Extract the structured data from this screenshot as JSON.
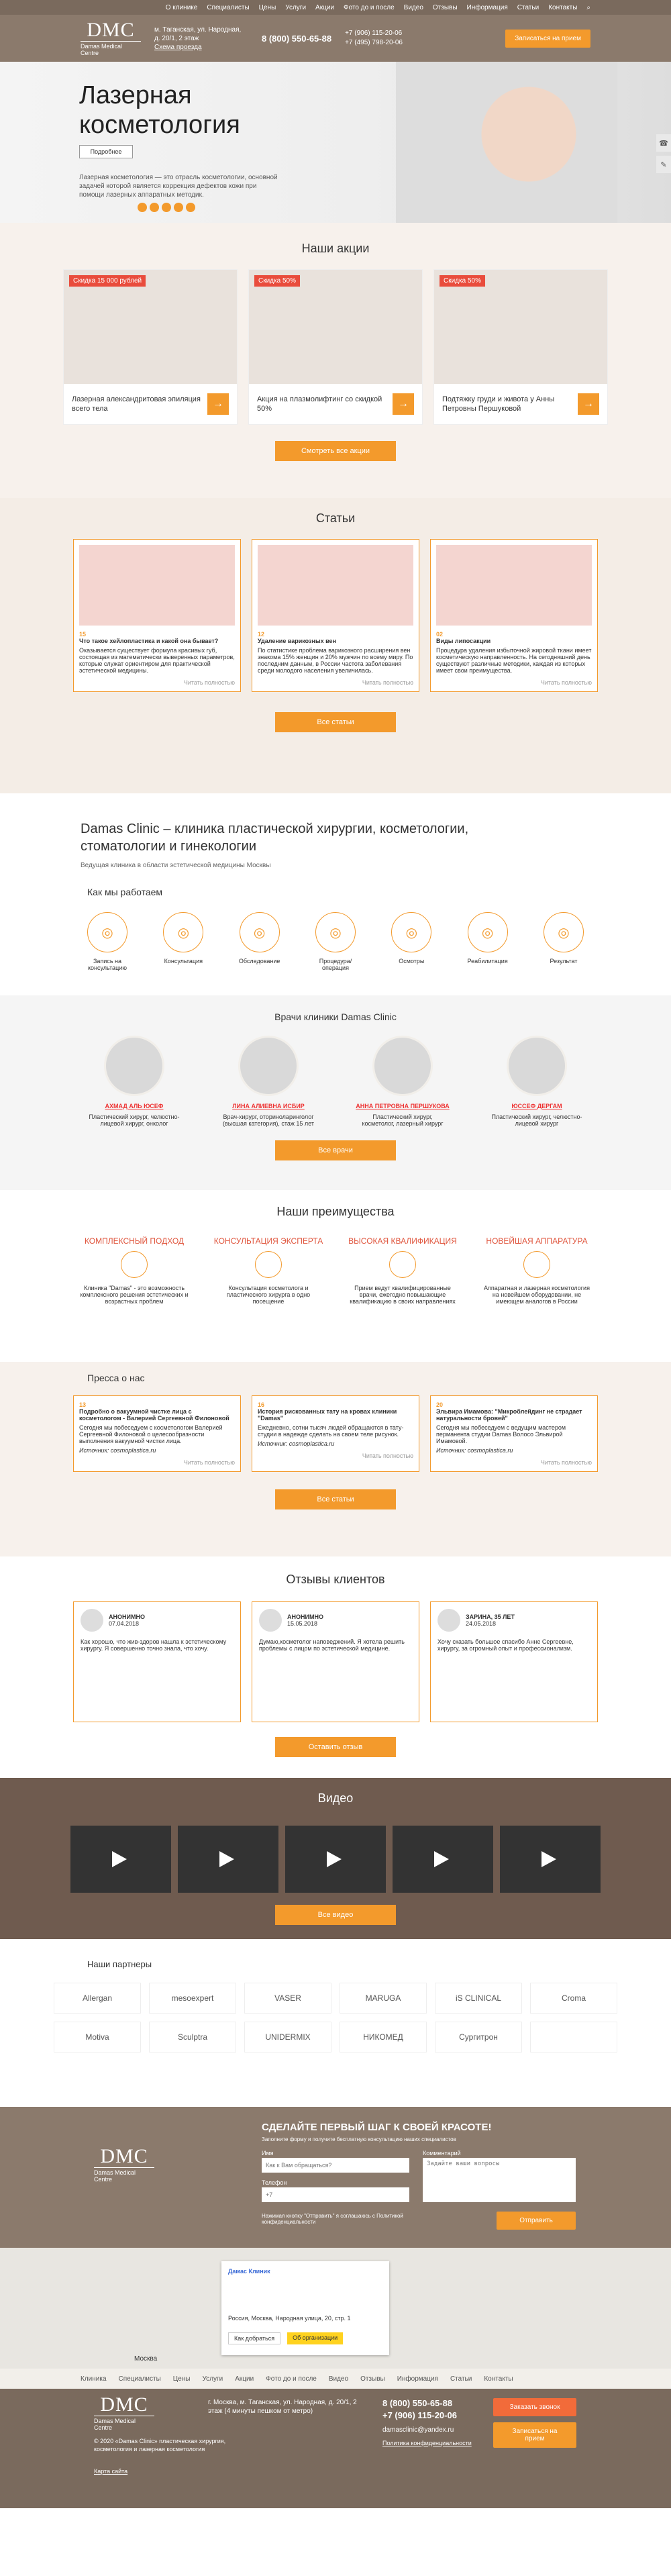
{
  "nav": {
    "items": [
      "О клинике",
      "Специалисты",
      "Цены",
      "Услуги",
      "Акции",
      "Фото до и после",
      "Видео",
      "Отзывы",
      "Информация",
      "Статьи",
      "Контакты"
    ]
  },
  "header": {
    "logo_main": "DMC",
    "logo_sub": "Damas Medical Centre",
    "address": "м. Таганская, ул. Народная, д. 20/1, 2 этаж",
    "address_link": "Схема проезда",
    "phone": "8 (800) 550-65-88",
    "phone2": "+7 (906) 115-20-06",
    "phone3": "+7 (495) 798-20-06",
    "cta": "Записаться на прием"
  },
  "hero": {
    "title": "Лазерная косметология",
    "button": "Подробнее",
    "text": "Лазерная косметология — это отрасль косметологии, основной задачей которой является коррекция дефектов кожи при помощи лазерных аппаратных методик."
  },
  "promos": {
    "title": "Наши акции",
    "button": "Смотреть все акции",
    "items": [
      {
        "tag": "Скидка 15 000 рублей",
        "text": "Лазерная александритовая эпиляция всего тела"
      },
      {
        "tag": "Скидка 50%",
        "text": "Акция на плазмолифтинг со скидкой 50%"
      },
      {
        "tag": "Скидка 50%",
        "text": "Подтяжку груди и живота у Анны Петровны Першуковой"
      }
    ]
  },
  "articles": {
    "title": "Статьи",
    "button": "Все статьи",
    "more": "Читать полностью",
    "items": [
      {
        "date": "15",
        "t": "Что такое хейлопластика и какой она бывает?",
        "d": "Оказывается существует формула красивых губ, состоящая из математически выверенных параметров, которые служат ориентиром для практической эстетической медицины."
      },
      {
        "date": "12",
        "t": "Удаление варикозных вен",
        "d": "По статистике проблема варикозного расширения вен знакома 15% женщин и 20% мужчин по всему миру. По последним данным, в России частота заболевания среди молодого населения увеличилась."
      },
      {
        "date": "02",
        "t": "Виды липосакции",
        "d": "Процедура удаления избыточной жировой ткани имеет косметическую направленность. На сегодняшний день существуют различные методики, каждая из которых имеет свои преимущества."
      }
    ]
  },
  "about": {
    "title": "Damas Clinic – клиника пластической хирургии, косметологии, стоматологии и гинекологии",
    "sub": "Ведущая клиника в области эстетической медицины Москвы"
  },
  "how": {
    "title": "Как мы работаем",
    "steps": [
      "Запись на консультацию",
      "Консультация",
      "Обследование",
      "Процедура/операция",
      "Осмотры",
      "Реабилитация",
      "Результат"
    ]
  },
  "doctors": {
    "title": "Врачи клиники Damas Clinic",
    "button": "Все врачи",
    "items": [
      {
        "name": "АХМАД АЛЬ ЮСЕФ",
        "role": "Пластический хирург, челюстно-лицевой хирург, онколог"
      },
      {
        "name": "ЛИНА АЛИЕВНА ИСБИР",
        "role": "Врач-хирург, оториноларинголог (высшая категория), стаж 15 лет"
      },
      {
        "name": "АННА ПЕТРОВНА ПЕРШУКОВА",
        "role": "Пластический хирург, косметолог, лазерный хирург"
      },
      {
        "name": "ЮССЕФ ДЕРГАМ",
        "role": "Пластический хирург, челюстно-лицевой хирург"
      }
    ]
  },
  "advantages": {
    "title": "Наши преимущества",
    "items": [
      {
        "h": "КОМПЛЕКСНЫЙ ПОДХОД",
        "d": "Клиника \"Damas\" - это возможность комплексного решения эстетических и возрастных проблем"
      },
      {
        "h": "КОНСУЛЬТАЦИЯ ЭКСПЕРТА",
        "d": "Консультация косметолога и пластического хирурга в одно посещение"
      },
      {
        "h": "ВЫСОКАЯ КВАЛИФИКАЦИЯ",
        "d": "Прием ведут квалифицированные врачи, ежегодно повышающие квалификацию в своих направлениях"
      },
      {
        "h": "НОВЕЙШАЯ АППАРАТУРА",
        "d": "Аппаратная и лазерная косметология на новейшем оборудовании, не имеющем аналогов в России"
      }
    ]
  },
  "press": {
    "title": "Пресса о нас",
    "button": "Все статьи",
    "more": "Читать полностью",
    "items": [
      {
        "date": "13",
        "t": "Подробно о вакуумной чистке лица с косметологом - Валерией Сергеевной Филоновой",
        "d": "Сегодня мы побеседуем с косметологом Валерией Сергеевной Филоновой о целесообразности выполнения вакуумной чистки лица.",
        "s": "Источник: cosmoplastica.ru"
      },
      {
        "date": "16",
        "t": "История рискованных тату на кровах клиники \"Damas\"",
        "d": "Ежедневно, сотни тысяч людей обращаются в тату-студии в надежде сделать на своем теле рисунок.",
        "s": "Источник: cosmoplastica.ru"
      },
      {
        "date": "20",
        "t": "Эльвира Имамова: \"Микроблейдинг не страдает натуральности бровей\"",
        "d": "Сегодня мы побеседуем с ведущим мастером перманента студии Damas Волосо Эльвирой Имамовой.",
        "s": "Источник: cosmoplastica.ru"
      }
    ]
  },
  "reviews": {
    "title": "Отзывы клиентов",
    "button": "Оставить отзыв",
    "items": [
      {
        "name": "АНОНИМНО",
        "date": "07.04.2018",
        "text": "Как хорошо, что жив-здоров нашла к эстетическому хирургу. Я совершенно точно знала, что хочу."
      },
      {
        "name": "АНОНИМНО",
        "date": "15.05.2018",
        "text": "Думаю,косметолог наповеджений. Я хотела решить проблемы с лицом по эстетической медицине."
      },
      {
        "name": "ЗАРИНА, 35 ЛЕТ",
        "date": "24.05.2018",
        "text": "Хочу сказать большое спасибо Анне Сергеевне, хирургу, за огромный опыт и профессионализм."
      }
    ]
  },
  "video": {
    "title": "Видео",
    "button": "Все видео"
  },
  "partners": {
    "title": "Наши партнеры",
    "items": [
      "Allergan",
      "mesoexpert",
      "VASER",
      "MARUGA",
      "iS CLINICAL",
      "Croma",
      "Motiva",
      "Sculptra",
      "UNIDERMIX",
      "НИКОМЕД",
      "Сургитрон",
      ""
    ]
  },
  "cta": {
    "title": "СДЕЛАЙТЕ ПЕРВЫЙ ШАГ К СВОЕЙ КРАСОТЕ!",
    "sub": "Заполните форму и получите бесплатную консультацию наших специалистов",
    "name_label": "Имя",
    "phone_label": "Телефон",
    "comment_label": "Комментарий",
    "name_ph": "Как к Вам обращаться?",
    "phone_ph": "+7",
    "comment_ph": "Задайте ваши вопросы",
    "button": "Отправить",
    "policy": "Нажимая кнопку \"Отправить\" я соглашаюсь с Политикой конфиденциальности"
  },
  "map": {
    "card_title": "Дамас Клиник",
    "card_addr": "Россия, Москва, Народная улица, 20, стр. 1",
    "route": "Как добраться",
    "link": "Об организации",
    "city": "Москва"
  },
  "footer": {
    "nav": [
      "Клиника",
      "Специалисты",
      "Цены",
      "Услуги",
      "Акции",
      "Фото до и после",
      "Видео",
      "Отзывы",
      "Информация",
      "Статьи",
      "Контакты"
    ],
    "address": "г. Москва, м. Таганская, ул. Народная, д. 20/1, 2 этаж (4 минуты пешком от метро)",
    "phone": "8 (800) 550-65-88",
    "phone2": "+7 (906) 115-20-06",
    "email": "damasclinic@yandex.ru",
    "btn1": "Заказать звонок",
    "btn2": "Записаться на прием",
    "copy": "© 2020 «Damas Clinic» пластическая хирургия, косметология и лазерная косметология",
    "policy": "Политика конфиденциальности",
    "sitemap": "Карта сайта"
  }
}
